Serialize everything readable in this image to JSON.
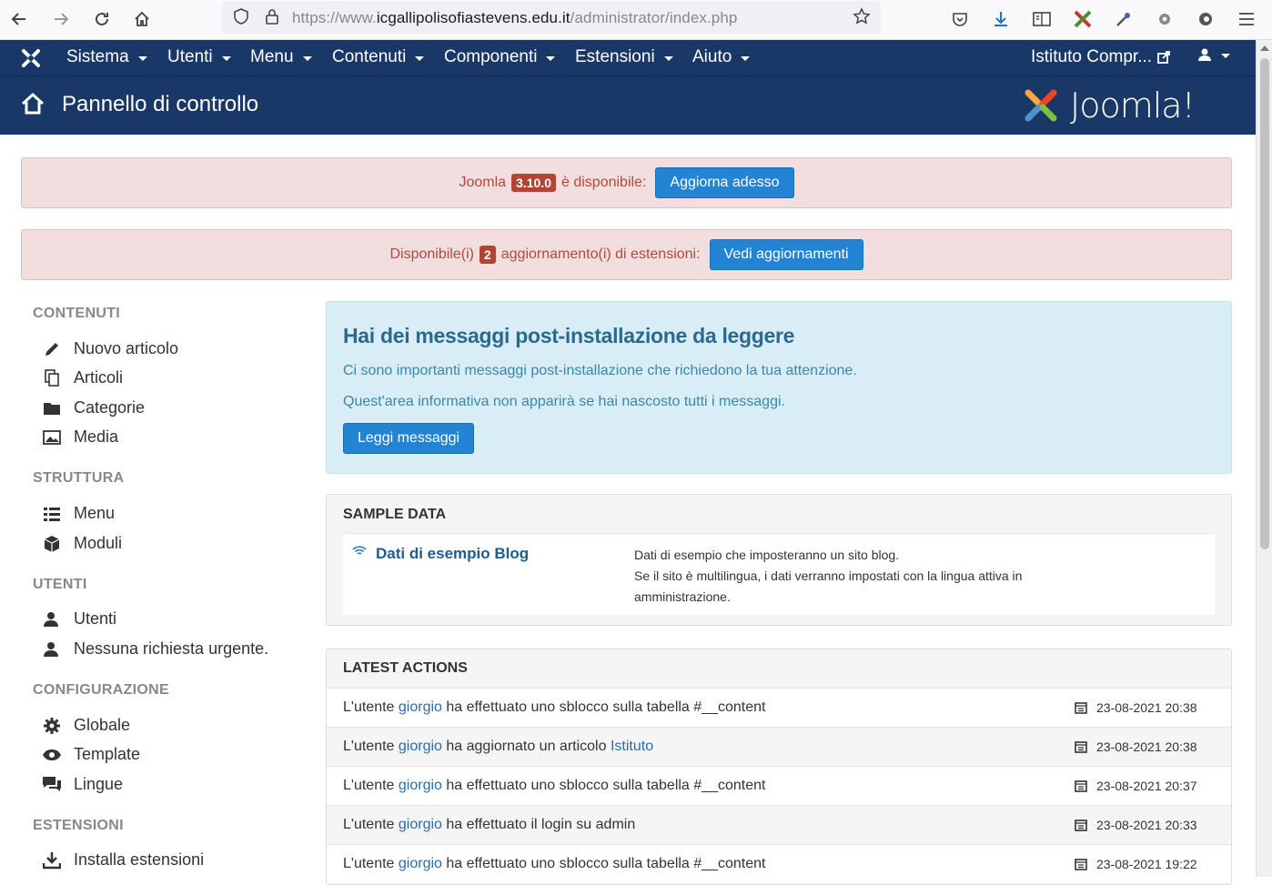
{
  "browser": {
    "url_prefix": "https://www.",
    "url_host": "icgallipolisofiastevens.edu.it",
    "url_path": "/administrator/index.php"
  },
  "topnav": {
    "items": [
      "Sistema",
      "Utenti",
      "Menu",
      "Contenuti",
      "Componenti",
      "Estensioni",
      "Aiuto"
    ],
    "site_name": "Istituto Compr..."
  },
  "header": {
    "title": "Pannello di controllo",
    "logo_text": "Joomla!"
  },
  "alerts": {
    "update_prefix": "Joomla",
    "update_version": "3.10.0",
    "update_suffix": "è disponibile:",
    "update_button": "Aggiorna adesso",
    "ext_prefix": "Disponibile(i)",
    "ext_count": "2",
    "ext_suffix": "aggiornamento(i) di estensioni:",
    "ext_button": "Vedi aggiornamenti"
  },
  "sidebar": {
    "sections": [
      {
        "title": "CONTENUTI",
        "items": [
          {
            "label": "Nuovo articolo",
            "icon": "pencil-icon"
          },
          {
            "label": "Articoli",
            "icon": "copy-icon"
          },
          {
            "label": "Categorie",
            "icon": "folder-icon"
          },
          {
            "label": "Media",
            "icon": "image-icon"
          }
        ]
      },
      {
        "title": "STRUTTURA",
        "items": [
          {
            "label": "Menu",
            "icon": "list-icon"
          },
          {
            "label": "Moduli",
            "icon": "cube-icon"
          }
        ]
      },
      {
        "title": "UTENTI",
        "items": [
          {
            "label": "Utenti",
            "icon": "users-icon"
          },
          {
            "label": "Nessuna richiesta urgente.",
            "icon": "users-icon"
          }
        ]
      },
      {
        "title": "CONFIGURAZIONE",
        "items": [
          {
            "label": "Globale",
            "icon": "cog-icon"
          },
          {
            "label": "Template",
            "icon": "eye-icon"
          },
          {
            "label": "Lingue",
            "icon": "comments-icon"
          }
        ]
      },
      {
        "title": "ESTENSIONI",
        "items": [
          {
            "label": "Installa estensioni",
            "icon": "download-icon"
          }
        ]
      }
    ]
  },
  "postinstall": {
    "title": "Hai dei messaggi post-installazione da leggere",
    "line1": "Ci sono importanti messaggi post-installazione che richiedono la tua attenzione.",
    "line2": "Quest'area informativa non apparirà se hai nascosto tutti i messaggi.",
    "button": "Leggi messaggi"
  },
  "sample_data": {
    "title": "SAMPLE DATA",
    "link": "Dati di esempio Blog",
    "desc_line1": "Dati di esempio che imposteranno un sito blog.",
    "desc_line2": "Se il sito è multilingua, i dati verranno impostati con la lingua attiva in",
    "desc_line3": "amministrazione."
  },
  "latest_actions": {
    "title": "LATEST ACTIONS",
    "rows": [
      {
        "prefix": "L'utente",
        "user": "giorgio",
        "action": "ha effettuato uno sblocco sulla tabella #__content",
        "link": "",
        "date": "23-08-2021 20:38"
      },
      {
        "prefix": "L'utente",
        "user": "giorgio",
        "action": "ha aggiornato un articolo",
        "link": "Istituto",
        "date": "23-08-2021 20:38"
      },
      {
        "prefix": "L'utente",
        "user": "giorgio",
        "action": "ha effettuato uno sblocco sulla tabella #__content",
        "link": "",
        "date": "23-08-2021 20:37"
      },
      {
        "prefix": "L'utente",
        "user": "giorgio",
        "action": "ha effettuato il login su admin",
        "link": "",
        "date": "23-08-2021 20:33"
      },
      {
        "prefix": "L'utente",
        "user": "giorgio",
        "action": "ha effettuato uno sblocco sulla tabella #__content",
        "link": "",
        "date": "23-08-2021 19:22"
      }
    ]
  }
}
